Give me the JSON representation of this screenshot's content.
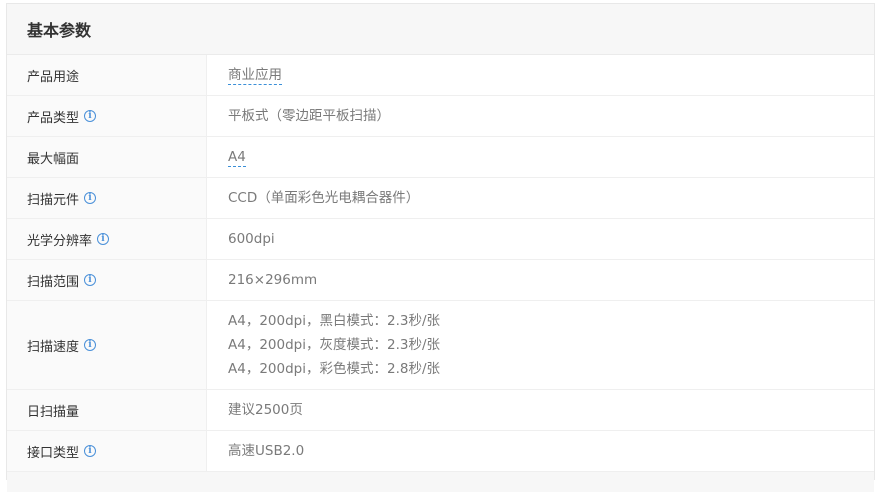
{
  "section": {
    "title": "基本参数"
  },
  "rows": [
    {
      "label": "产品用途",
      "info": false,
      "values": [
        "商业应用"
      ],
      "link": true
    },
    {
      "label": "产品类型",
      "info": true,
      "values": [
        "平板式（零边距平板扫描）"
      ],
      "link": false
    },
    {
      "label": "最大幅面",
      "info": false,
      "values": [
        "A4"
      ],
      "link": true
    },
    {
      "label": "扫描元件",
      "info": true,
      "values": [
        "CCD（单面彩色光电耦合器件）"
      ],
      "link": false
    },
    {
      "label": "光学分辨率",
      "info": true,
      "values": [
        "600dpi"
      ],
      "link": false
    },
    {
      "label": "扫描范围",
      "info": true,
      "values": [
        "216×296mm"
      ],
      "link": false
    },
    {
      "label": "扫描速度",
      "info": true,
      "values": [
        "A4，200dpi，黑白模式：2.3秒/张",
        "A4，200dpi，灰度模式：2.3秒/张",
        "A4，200dpi，彩色模式：2.8秒/张"
      ],
      "link": false
    },
    {
      "label": "日扫描量",
      "info": false,
      "values": [
        "建议2500页"
      ],
      "link": false
    },
    {
      "label": "接口类型",
      "info": true,
      "values": [
        "高速USB2.0"
      ],
      "link": false
    }
  ],
  "icons": {
    "info": "info-circle-icon"
  },
  "colors": {
    "link_underline": "#3a8fd8",
    "info_icon": "#4a90d9",
    "header_bg": "#f7f7f7"
  }
}
